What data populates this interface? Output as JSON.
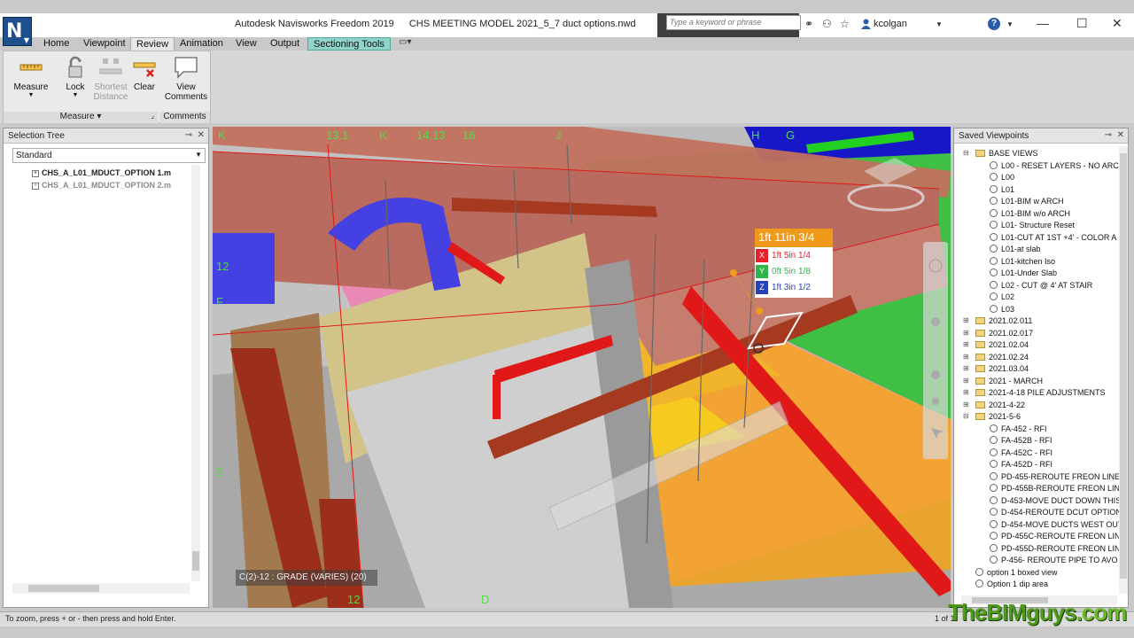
{
  "window": {
    "app_title": "Autodesk Navisworks Freedom 2019",
    "file_title": "CHS MEETING MODEL 2021_5_7 duct options.nwd",
    "search_placeholder": "Type a keyword or phrase",
    "user": "kcolgan",
    "logo_letter": "N"
  },
  "tabs": [
    {
      "label": "Home"
    },
    {
      "label": "Viewpoint"
    },
    {
      "label": "Review"
    },
    {
      "label": "Animation"
    },
    {
      "label": "View"
    },
    {
      "label": "Output"
    },
    {
      "label": "Sectioning Tools"
    }
  ],
  "ribbon": {
    "measure": "Measure",
    "lock": "Lock",
    "shortest_distance_1": "Shortest",
    "shortest_distance_2": "Distance",
    "clear": "Clear",
    "view_comments_1": "View",
    "view_comments_2": "Comments",
    "group_measure": "Measure",
    "group_comments": "Comments"
  },
  "selection_tree": {
    "title": "Selection Tree",
    "dropdown_value": "Standard",
    "items": [
      {
        "label": "CHS_A_L01_MDUCT_OPTION 1.m"
      },
      {
        "label": "CHS_A_L01_MDUCT_OPTION 2.m"
      }
    ]
  },
  "saved_viewpoints": {
    "title": "Saved Viewpoints",
    "items": [
      {
        "label": "BASE VIEWS",
        "type": "folder"
      },
      {
        "label": "L00 - RESET LAYERS - NO ARCH",
        "type": "view"
      },
      {
        "label": "L00",
        "type": "view"
      },
      {
        "label": "L01",
        "type": "view"
      },
      {
        "label": "L01-BIM w ARCH",
        "type": "view"
      },
      {
        "label": "L01-BIM w/o ARCH",
        "type": "view"
      },
      {
        "label": "L01- Structure Reset",
        "type": "view"
      },
      {
        "label": "L01-CUT AT 1ST +4' - COLOR A",
        "type": "view"
      },
      {
        "label": "L01-at slab",
        "type": "view"
      },
      {
        "label": "L01-kitchen Iso",
        "type": "view"
      },
      {
        "label": "L01-Under Slab",
        "type": "view"
      },
      {
        "label": "L02 - CUT @ 4' AT STAIR",
        "type": "view"
      },
      {
        "label": "L02",
        "type": "view"
      },
      {
        "label": "L03",
        "type": "view"
      },
      {
        "label": "2021.02.011",
        "type": "folder"
      },
      {
        "label": "2021.02.017",
        "type": "folder"
      },
      {
        "label": "2021.02.04",
        "type": "folder"
      },
      {
        "label": "2021.02.24",
        "type": "folder"
      },
      {
        "label": "2021.03.04",
        "type": "folder"
      },
      {
        "label": "2021 - MARCH",
        "type": "folder"
      },
      {
        "label": "2021-4-18 PILE ADJUSTMENTS",
        "type": "folder"
      },
      {
        "label": "2021-4-22",
        "type": "folder"
      },
      {
        "label": "2021-5-6",
        "type": "folder"
      },
      {
        "label": "FA-452 - RFI",
        "type": "view"
      },
      {
        "label": "FA-452B - RFI",
        "type": "view"
      },
      {
        "label": "FA-452C - RFI",
        "type": "view"
      },
      {
        "label": "FA-452D - RFI",
        "type": "view"
      },
      {
        "label": "PD-455-REROUTE FREON LINE",
        "type": "view"
      },
      {
        "label": "PD-455B-REROUTE FREON LIN",
        "type": "view"
      },
      {
        "label": "D-453-MOVE DUCT DOWN THIS",
        "type": "view"
      },
      {
        "label": "D-454-REROUTE DCUT OPTION",
        "type": "view"
      },
      {
        "label": "D-454-MOVE DUCTS WEST OUT",
        "type": "view"
      },
      {
        "label": "PD-455C-REROUTE FREON LIN",
        "type": "view"
      },
      {
        "label": "PD-455D-REROUTE FREON LIN",
        "type": "view"
      },
      {
        "label": "P-456- REROUTE PIPE TO AVO",
        "type": "view"
      },
      {
        "label": "option 1 boxed view",
        "type": "view"
      },
      {
        "label": "Option 1 dip area",
        "type": "view"
      }
    ]
  },
  "measurement": {
    "total": "1ft 11in 3/4",
    "x": "1ft 5in 1/4",
    "y": "0ft 5in 1/8",
    "z": "1ft 3in 1/2",
    "x_label": "X",
    "y_label": "Y",
    "z_label": "Z"
  },
  "grid_labels": [
    "K",
    "13.1",
    "K",
    "14.13",
    "16",
    "J",
    "H",
    "G",
    "12",
    "F",
    "E",
    "12",
    "D"
  ],
  "viewport_tip": "C(2)-12 : GRADE (VARIES) (20)",
  "status": {
    "hint": "To zoom, press + or - then press and hold Enter.",
    "page": "1 of 1"
  },
  "watermark": {
    "brand": "TheBIMguys",
    "suffix": ".com"
  },
  "colors": {
    "logo_blue": "#1d4f8c",
    "measure_orange": "#f09a1c",
    "axis_x": "#e8202a",
    "axis_y": "#2fb34a",
    "axis_z": "#2840b8"
  }
}
